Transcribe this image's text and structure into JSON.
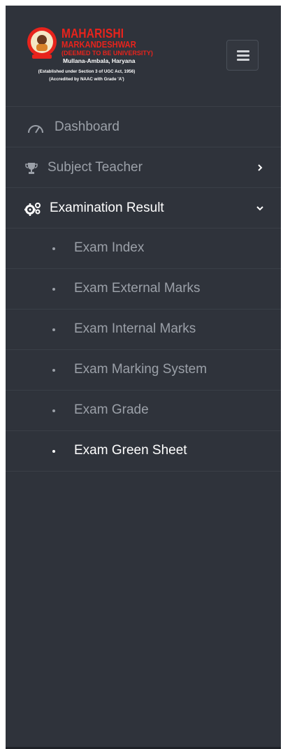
{
  "brand": {
    "title": "MAHARISHI",
    "subtitle": "MARKANDESHWAR",
    "deemed": "(DEEMED TO BE UNIVERSITY)",
    "place": "Mullana-Ambala, Haryana",
    "established": "(Established under Section 3 of UGC Act, 1956)",
    "accredited": "(Accredited by NAAC with Grade 'A')"
  },
  "colors": {
    "sidebar_bg": "#2f333b",
    "text_muted": "#9ba0a8",
    "text_active": "#ffffff",
    "brand_red": "#e8231c"
  },
  "menu": {
    "dashboard": {
      "label": "Dashboard",
      "icon": "speedometer-icon"
    },
    "subject_teacher": {
      "label": "Subject Teacher",
      "icon": "trophy-icon"
    },
    "examination_result": {
      "label": "Examination Result",
      "icon": "gears-icon"
    }
  },
  "submenu": [
    {
      "label": "Exam Index"
    },
    {
      "label": "Exam External Marks"
    },
    {
      "label": "Exam Internal Marks"
    },
    {
      "label": "Exam Marking System"
    },
    {
      "label": "Exam Grade"
    },
    {
      "label": "Exam Green Sheet"
    }
  ]
}
